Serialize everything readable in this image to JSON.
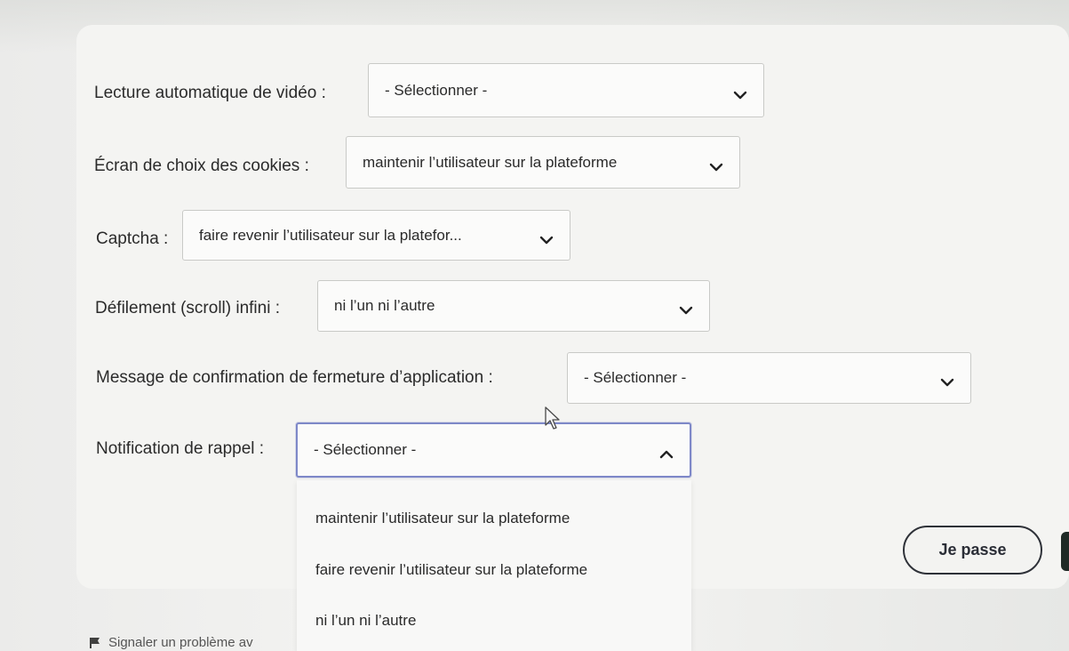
{
  "form": {
    "rows": [
      {
        "label": "Lecture automatique de vidéo :",
        "value": "- Sélectionner -"
      },
      {
        "label": "Écran de choix des cookies :",
        "value": "maintenir l’utilisateur sur la plateforme"
      },
      {
        "label": "Captcha :",
        "value": "faire revenir l’utilisateur sur la platefor..."
      },
      {
        "label": "Défilement (scroll) infini :",
        "value": "ni l’un ni l’autre"
      },
      {
        "label": "Message de confirmation de fermeture d’application :",
        "value": "- Sélectionner -"
      },
      {
        "label": "Notification de rappel :",
        "value": "- Sélectionner -"
      }
    ],
    "dropdown_options": [
      "maintenir l’utilisateur sur la plateforme",
      "faire revenir l’utilisateur sur la plateforme",
      "ni l’un ni l’autre"
    ]
  },
  "actions": {
    "skip_label": "Je passe"
  },
  "footer": {
    "report_label": "Signaler un problème av"
  },
  "colors": {
    "focus_border": "#7e88c8",
    "button_border": "#2e3138"
  }
}
